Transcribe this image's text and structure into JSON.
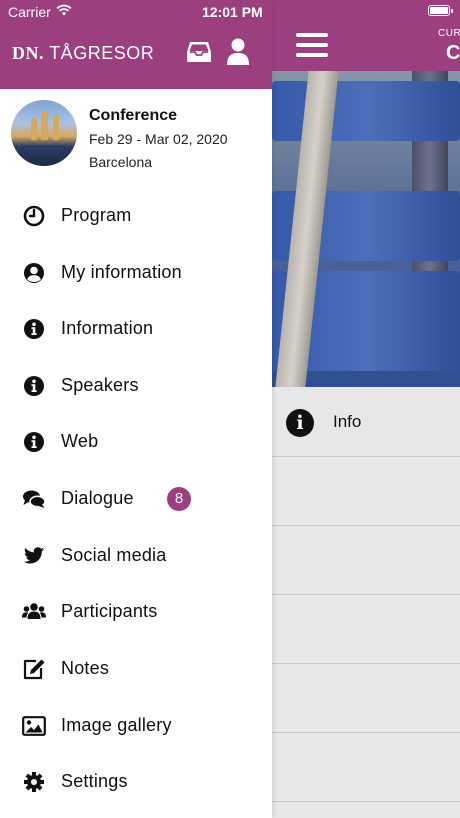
{
  "status_bar": {
    "carrier": "Carrier",
    "time": "12:01 PM"
  },
  "brand": {
    "logo_bold": "DN.",
    "logo_text": "TÅGRESOR",
    "accent_color": "#9b3f7e"
  },
  "background_page": {
    "header_subtitle": "CUR",
    "header_title": "C",
    "list": [
      {
        "icon": "info-icon",
        "label": "Info"
      }
    ]
  },
  "conference": {
    "title": "Conference",
    "dates": "Feb 29 - Mar 02, 2020",
    "city": "Barcelona"
  },
  "menu": [
    {
      "label": "Program",
      "icon": "clock-icon"
    },
    {
      "label": "My information",
      "icon": "user-circle-icon"
    },
    {
      "label": "Information",
      "icon": "info-icon"
    },
    {
      "label": "Speakers",
      "icon": "info-icon"
    },
    {
      "label": "Web",
      "icon": "info-icon"
    },
    {
      "label": "Dialogue",
      "icon": "chat-icon",
      "badge": "8"
    },
    {
      "label": "Social media",
      "icon": "twitter-icon"
    },
    {
      "label": "Participants",
      "icon": "users-icon"
    },
    {
      "label": "Notes",
      "icon": "edit-icon"
    },
    {
      "label": "Image gallery",
      "icon": "image-icon"
    },
    {
      "label": "Settings",
      "icon": "gear-icon"
    }
  ]
}
